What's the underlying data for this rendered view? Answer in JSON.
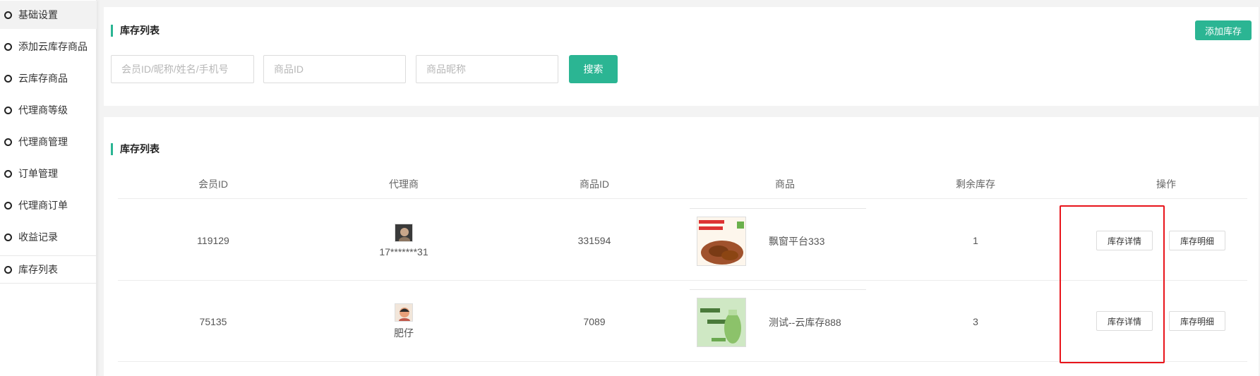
{
  "sidebar": {
    "items": [
      {
        "label": "基础设置"
      },
      {
        "label": "添加云库存商品"
      },
      {
        "label": "云库存商品"
      },
      {
        "label": "代理商等级"
      },
      {
        "label": "代理商管理"
      },
      {
        "label": "订单管理"
      },
      {
        "label": "代理商订单"
      },
      {
        "label": "收益记录"
      },
      {
        "label": "库存列表"
      }
    ]
  },
  "search_panel": {
    "title": "库存列表",
    "add_button": "添加库存",
    "member_placeholder": "会员ID/昵称/姓名/手机号",
    "product_id_placeholder": "商品ID",
    "product_name_placeholder": "商品昵称",
    "search_button": "搜索"
  },
  "list_panel": {
    "title": "库存列表",
    "columns": [
      "会员ID",
      "代理商",
      "商品ID",
      "商品",
      "剩余库存",
      "操作"
    ],
    "rows": [
      {
        "member_id": "119129",
        "agent": "17*******31",
        "product_id": "331594",
        "product_name": "飘窗平台333",
        "stock": "1",
        "detail_button": "库存详情",
        "ledger_button": "库存明细"
      },
      {
        "member_id": "75135",
        "agent": "肥仔",
        "product_id": "7089",
        "product_name": "测试--云库存888",
        "stock": "3",
        "detail_button": "库存详情",
        "ledger_button": "库存明细"
      }
    ]
  },
  "colors": {
    "accent": "#2bb593",
    "highlight_border": "#e8141b"
  }
}
